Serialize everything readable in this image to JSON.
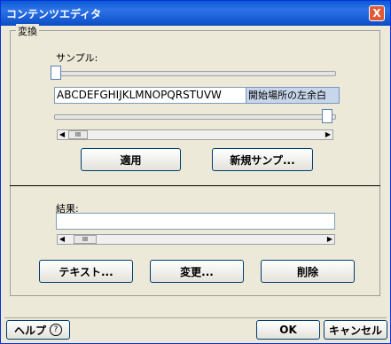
{
  "window": {
    "title": "コンテンツエディタ",
    "close_glyph": "X"
  },
  "group": {
    "title": "変換"
  },
  "sample": {
    "label": "サンプル:",
    "text": "ABCDEFGHIJKLMNOPQRSTUVW",
    "tooltip": "開始場所の左余白",
    "thumb_glyph": "III"
  },
  "buttons": {
    "apply": "適用",
    "new_sample": "新規サンプ...",
    "text": "テキスト...",
    "change": "変更...",
    "delete": "削除",
    "help": "ヘルプ",
    "help_icon": "?",
    "ok": "OK",
    "cancel": "キャンセル"
  },
  "result": {
    "label": "結果:",
    "value": "",
    "thumb_glyph": "III"
  },
  "scroll": {
    "left_arrow": "◀",
    "right_arrow": "▶"
  }
}
